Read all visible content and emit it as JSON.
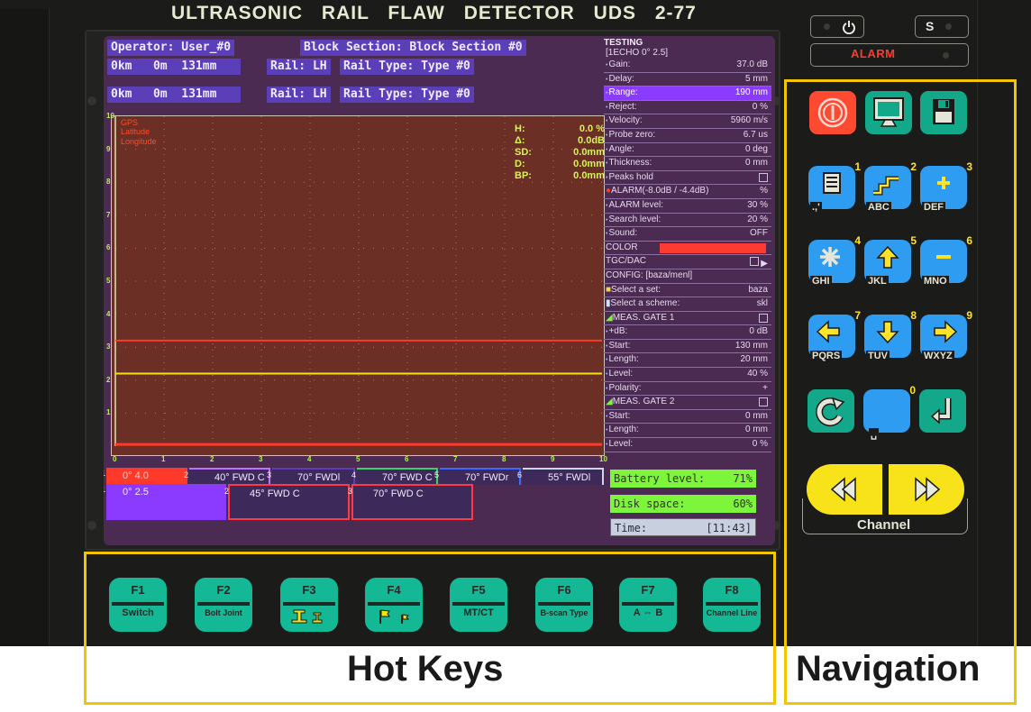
{
  "device": {
    "title": "ULTRASONIC  RAIL  FLAW  DETECTOR  UDS 2-77"
  },
  "header": {
    "operator": "Operator: User_#0",
    "block_section": "Block Section: Block Section #0",
    "rows": [
      {
        "position": "0km   0m  131mm",
        "rail": "Rail: LH",
        "rail_type": "Rail Type: Type #0"
      },
      {
        "position": "0km   0m  131mm",
        "rail": "Rail: LH",
        "rail_type": "Rail Type: Type #0"
      }
    ]
  },
  "ascan": {
    "gps_label": "GPS",
    "latitude_label": "Latitude",
    "longitude_label": "Longitude",
    "y_ticks": [
      "1",
      "2",
      "3",
      "4",
      "5",
      "6",
      "7",
      "8",
      "9",
      "10"
    ],
    "x_ticks": [
      "0",
      "1",
      "2",
      "3",
      "4",
      "5",
      "6",
      "7",
      "8",
      "9",
      "10"
    ],
    "measurements": [
      {
        "label": "H:",
        "value": "0.0 %"
      },
      {
        "label": "Δ:",
        "value": "0.0dB"
      },
      {
        "label": "SD:",
        "value": "0.0mm"
      },
      {
        "label": "D:",
        "value": "0.0mm"
      },
      {
        "label": "BP:",
        "value": "0.0mm"
      }
    ],
    "lines": {
      "gate1_level_div": 3.2,
      "gate_yellow_level_div": 2.2,
      "baseline_div": 0.05,
      "gate_red_color": "#ff3a2a",
      "gate_yellow_color": "#f2e21a"
    }
  },
  "channels_row1": [
    {
      "num": "1",
      "label": "0° 4.0",
      "color": "#ff3a2a",
      "active": true
    },
    {
      "num": "2",
      "label": "40° FWD C",
      "color": "#c070ff"
    },
    {
      "num": "3",
      "label": "70° FWDl",
      "color": "#5a3fb8"
    },
    {
      "num": "4",
      "label": "70° FWD C",
      "color": "#3ad06a"
    },
    {
      "num": "5",
      "label": "70° FWDr",
      "color": "#3a6aff"
    },
    {
      "num": "6",
      "label": "55° FWDl",
      "color": "#c8d8f0"
    }
  ],
  "channels_row2": [
    {
      "num": "1",
      "label": "0° 2.5",
      "color": "#8b3bff",
      "active": true
    },
    {
      "num": "2",
      "label": "45° FWD C",
      "color": "#ff3a40"
    },
    {
      "num": "3",
      "label": "70° FWD C",
      "color": "#ff3a40"
    }
  ],
  "side_panel": {
    "title": "TESTING",
    "echo_header": "[1ECHO  0° 2.5]",
    "rows": [
      {
        "label": "Gain:",
        "value": "37.0 dB",
        "sub": true
      },
      {
        "label": "Delay:",
        "value": "5 mm",
        "sub": true
      },
      {
        "label": "Range:",
        "value": "190 mm",
        "sub": true,
        "highlight": true
      },
      {
        "label": "Reject:",
        "value": "0 %",
        "sub": true
      },
      {
        "label": "Velocity:",
        "value": "5960 m/s",
        "sub": true
      },
      {
        "label": "Probe zero:",
        "value": "6.7 us",
        "sub": true
      },
      {
        "label": "Angle:",
        "value": "0 deg",
        "sub": true
      },
      {
        "label": "Thickness:",
        "value": "0 mm",
        "sub": true
      },
      {
        "label": "Peaks hold",
        "value": "",
        "sub": true,
        "checkbox": true
      },
      {
        "label": "ALARM(-8.0dB / -4.4dB)",
        "value": "%",
        "sub": false,
        "alarm": true
      },
      {
        "label": "ALARM level:",
        "value": "30 %",
        "sub": true
      },
      {
        "label": "Search level:",
        "value": "20 %",
        "sub": true
      },
      {
        "label": "Sound:",
        "value": "OFF",
        "sub": true
      },
      {
        "label": "COLOR",
        "value": "",
        "sub": false,
        "colorbar": "#ff3a30"
      },
      {
        "label": "TGC/DAC",
        "value": "▶",
        "sub": false,
        "checkbox": true
      },
      {
        "label": "CONFIG: [baza/menl]",
        "value": "",
        "sub": false
      },
      {
        "label": "Select a set:",
        "value": "baza",
        "sub": false,
        "icon": "folder"
      },
      {
        "label": "Select a scheme:",
        "value": "skl",
        "sub": false,
        "icon": "doc"
      },
      {
        "label": "MEAS. GATE 1",
        "value": "",
        "sub": false,
        "checkbox": true,
        "icon": "gate"
      },
      {
        "label": "+dB:",
        "value": "0 dB",
        "sub": true
      },
      {
        "label": "Start:",
        "value": "130 mm",
        "sub": true
      },
      {
        "label": "Length:",
        "value": "20 mm",
        "sub": true
      },
      {
        "label": "Level:",
        "value": "40 %",
        "sub": true
      },
      {
        "label": "Polarity:",
        "value": "+",
        "sub": true
      },
      {
        "label": "MEAS. GATE 2",
        "value": "",
        "sub": false,
        "checkbox": true,
        "icon": "gate"
      },
      {
        "label": "Start:",
        "value": "0 mm",
        "sub": true
      },
      {
        "label": "Length:",
        "value": "0 mm",
        "sub": true
      },
      {
        "label": "Level:",
        "value": "0 %",
        "sub": true
      }
    ]
  },
  "status": {
    "battery_label": "Battery level:",
    "battery_value": "71%",
    "disk_label": "Disk space:",
    "disk_value": "60%",
    "time_label": "Time:",
    "time_value": "[11:43]"
  },
  "indicators": {
    "power_icon": "power-icon",
    "s_label": "S",
    "alarm_label": "ALARM"
  },
  "nav_keys": {
    "top": [
      {
        "name": "power-button",
        "icon": "power-icon"
      },
      {
        "name": "display-button",
        "icon": "monitor-icon"
      },
      {
        "name": "save-button",
        "icon": "floppy-disk-icon"
      }
    ],
    "numeric": [
      {
        "num": "1",
        "letters": ".,'",
        "icon": "list-icon"
      },
      {
        "num": "2",
        "letters": "ABC",
        "icon": "stairs-icon"
      },
      {
        "num": "3",
        "letters": "DEF",
        "icon": "plus-icon"
      },
      {
        "num": "4",
        "letters": "GHI",
        "icon": "asterisk-icon"
      },
      {
        "num": "5",
        "letters": "JKL",
        "icon": "arrow-up-icon"
      },
      {
        "num": "6",
        "letters": "MNO",
        "icon": "minus-icon"
      },
      {
        "num": "7",
        "letters": "PQRS",
        "icon": "arrow-left-icon"
      },
      {
        "num": "8",
        "letters": "TUV",
        "icon": "arrow-down-icon"
      },
      {
        "num": "9",
        "letters": "WXYZ",
        "icon": "arrow-right-icon"
      }
    ],
    "bottom": [
      {
        "name": "refresh-button",
        "icon": "rotate-icon"
      },
      {
        "name": "zero-key",
        "num": "0",
        "letters": "␣"
      },
      {
        "name": "enter-button",
        "icon": "enter-icon"
      }
    ],
    "channel_label": "Channel"
  },
  "hot_keys": [
    {
      "key": "F1",
      "label": "Switch"
    },
    {
      "key": "F2",
      "label": "Bolt Joint"
    },
    {
      "key": "F3",
      "label": "",
      "icon": "rail-profile-icon"
    },
    {
      "key": "F4",
      "label": "",
      "icon": "flag-icon"
    },
    {
      "key": "F5",
      "label": "MT/CT"
    },
    {
      "key": "F6",
      "label": "B-scan Type"
    },
    {
      "key": "F7",
      "label": "A ⇔ B"
    },
    {
      "key": "F8",
      "label": "Channel Line"
    }
  ],
  "captions": {
    "hot_keys": "Hot Keys",
    "navigation": "Navigation"
  }
}
